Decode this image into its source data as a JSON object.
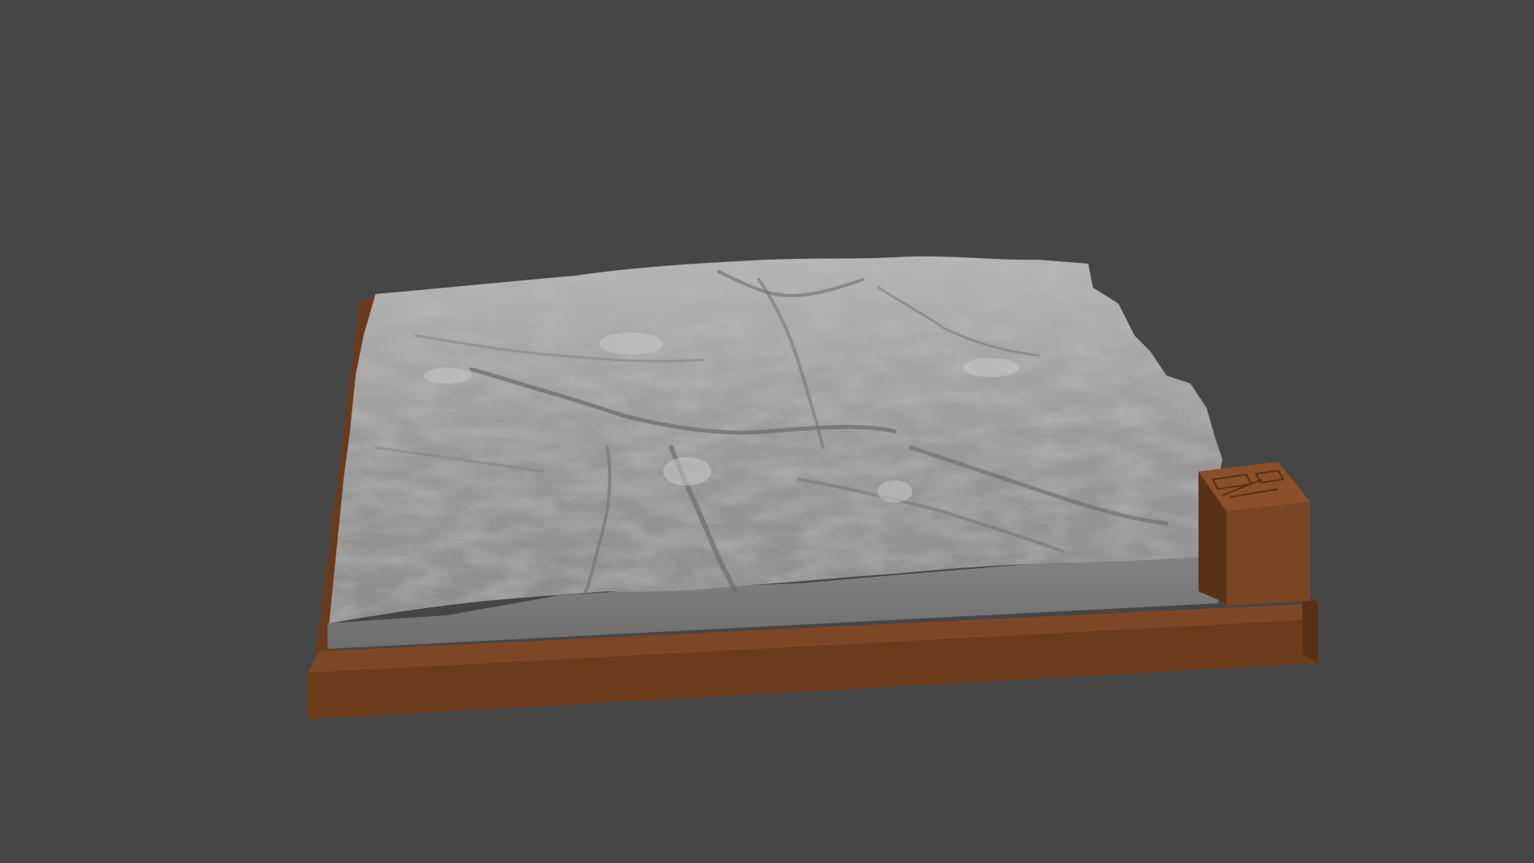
{
  "scene": {
    "background_color": "#464646",
    "subject": "terrain-relief-model",
    "colors": {
      "terrain_light": "#a9a9a9",
      "terrain_mid": "#8f8f8f",
      "terrain_shadow": "#6a6a6a",
      "terrain_wall": "#7a7a7a",
      "base_top": "#7a4522",
      "base_front": "#6b3b1c",
      "base_side": "#5a3116",
      "label_block": "#7c4624"
    }
  }
}
